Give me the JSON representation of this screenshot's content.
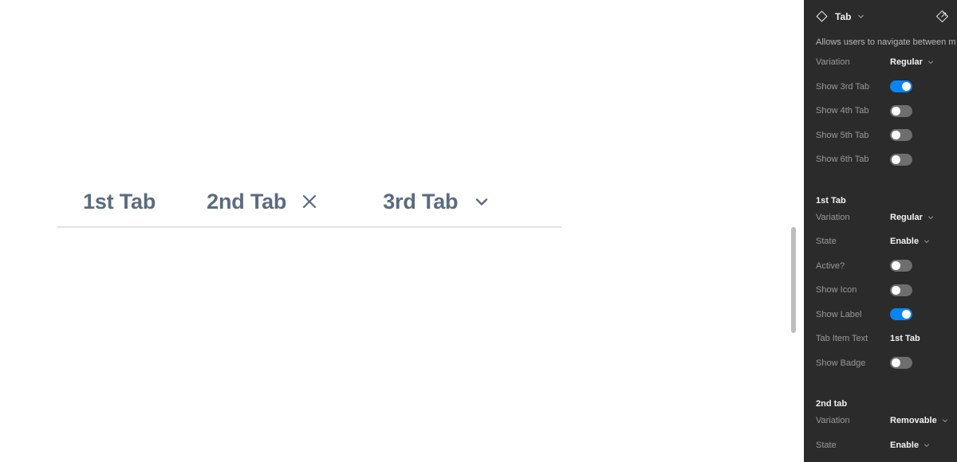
{
  "canvas": {
    "component": "tabs",
    "tabs": [
      {
        "label": "1st Tab",
        "icon": "none",
        "variation": "Regular"
      },
      {
        "label": "2nd Tab",
        "icon": "close-icon",
        "variation": "Removable"
      },
      {
        "label": "3rd Tab",
        "icon": "chevron-down-icon",
        "variation": "Dropdown"
      }
    ],
    "underline_color": "#dde3ea",
    "label_color": "#5b6b80",
    "scrollbar": {
      "visible": true,
      "thumb_color": "#bdbdbd"
    }
  },
  "panel": {
    "header": {
      "icon": "diamond-component-icon",
      "title": "Tab",
      "chevron": "chevron-down-icon",
      "open_icon": "open-in-new-icon"
    },
    "description": "Allows users to navigate between m",
    "accent_color": "#0b84f3",
    "background_color": "#2b2b2b",
    "label_color": "#9a9a9a",
    "rows": [
      {
        "type": "select",
        "label": "Variation",
        "value": "Regular"
      },
      {
        "type": "toggle",
        "label": "Show 3rd Tab",
        "value": true
      },
      {
        "type": "toggle",
        "label": "Show 4th Tab",
        "value": false
      },
      {
        "type": "toggle",
        "label": "Show 5th Tab",
        "value": false
      },
      {
        "type": "toggle",
        "label": "Show 6th Tab",
        "value": false
      },
      {
        "type": "section",
        "label": "1st Tab"
      },
      {
        "type": "select",
        "label": "Variation",
        "value": "Regular"
      },
      {
        "type": "select",
        "label": "State",
        "value": "Enable"
      },
      {
        "type": "toggle",
        "label": "Active?",
        "value": false
      },
      {
        "type": "toggle",
        "label": "Show Icon",
        "value": false
      },
      {
        "type": "toggle",
        "label": "Show Label",
        "value": true
      },
      {
        "type": "text",
        "label": "Tab Item Text",
        "value": "1st Tab"
      },
      {
        "type": "toggle",
        "label": "Show Badge",
        "value": false
      },
      {
        "type": "section",
        "label": "2nd tab"
      },
      {
        "type": "select",
        "label": "Variation",
        "value": "Removable"
      },
      {
        "type": "select",
        "label": "State",
        "value": "Enable"
      }
    ]
  }
}
